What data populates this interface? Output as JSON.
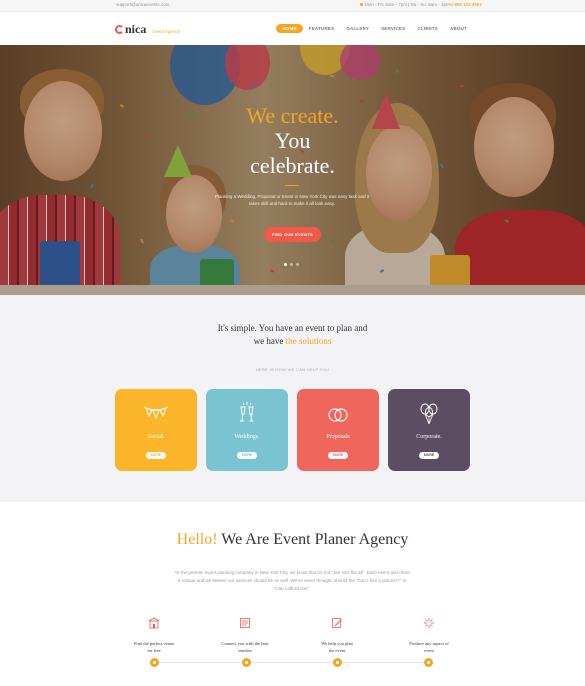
{
  "topbar": {
    "email": "support@unicaevents.com",
    "hours": "Mon - Fri: 8am - 7pm | Sa - Su: 9am - 4pm",
    "phone": "+1 800 123 4567"
  },
  "header": {
    "logo_name": "nica",
    "logo_tag": "Event Agency",
    "nav": [
      "HOME",
      "FEATURES",
      "GALLERY",
      "SERVICES",
      "CLIENTS",
      "ABOUT"
    ]
  },
  "hero": {
    "title_line1": "We create.",
    "title_line2": "You",
    "title_line3": "celebrate.",
    "subtitle": "Planning a Wedding, Proposal or Event in New York City was easy task and it takes skill and hard to make it all look easy.",
    "cta": "FIND OUR EVENTS"
  },
  "solutions": {
    "heading_line1": "It's simple. You have an event to plan and",
    "heading_line2_a": "we have",
    "heading_line2_b": "the solutions",
    "small": "HERE IS HOW WE CAN HELP YOU",
    "cards": [
      {
        "label": "Social.",
        "more": "MORE",
        "color": "#fbb52a",
        "icon": "bunting-icon"
      },
      {
        "label": "Weddings.",
        "more": "MORE",
        "color": "#79c4d0",
        "icon": "champagne-glasses-icon"
      },
      {
        "label": "Proposals",
        "more": "MORE",
        "color": "#f0665c",
        "icon": "rings-icon"
      },
      {
        "label": "Corporate.",
        "more": "MORE",
        "color": "#5b4e62",
        "icon": "balloons-icon"
      }
    ]
  },
  "about": {
    "heading_a": "Hello!",
    "heading_b": "We Are Event Planer Agency",
    "paragraph": "As the premier event planning company in New York City, we know that it's not \"one size fits all\". Each event and client is unique and we believe our services should be as well. We've never thought, should the \"Can I hire a planner?\" or \"Can I afford one\".",
    "features": [
      {
        "line1": "Find the perfect venue",
        "line2": "for free",
        "icon": "venue-icon"
      },
      {
        "line1": "Connect you with the best",
        "line2": "vendors",
        "icon": "vendors-icon"
      },
      {
        "line1": "We help you plan",
        "line2": "the event",
        "icon": "plan-icon"
      },
      {
        "line1": "Produce any aspect of",
        "line2": "event",
        "icon": "fireworks-icon"
      }
    ]
  },
  "colors": {
    "accent": "#f4a623",
    "coral": "#f05a4b"
  }
}
